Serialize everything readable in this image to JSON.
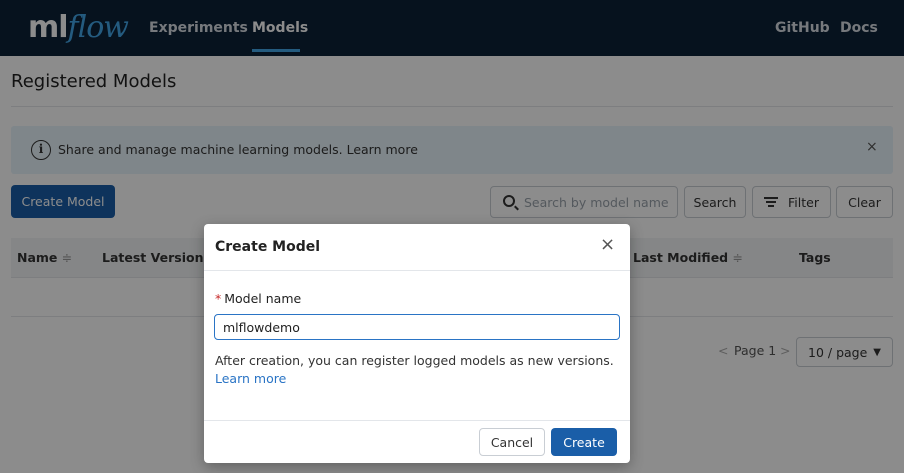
{
  "nav": {
    "logo_ml": "ml",
    "logo_flow": "flow",
    "experiments": "Experiments",
    "models": "Models",
    "github": "GitHub",
    "docs": "Docs"
  },
  "page": {
    "title": "Registered Models",
    "banner_text": "Share and manage machine learning models. Learn more",
    "banner_close": "×",
    "info_icon": "i",
    "create_model_label": "Create Model",
    "search_placeholder": "Search by model name",
    "search_label": "Search",
    "filter_label": "Filter",
    "clear_label": "Clear"
  },
  "table": {
    "columns": [
      {
        "label": "Name",
        "sort": "≑"
      },
      {
        "label": "Latest Version",
        "sort": ""
      },
      {
        "label": "Last Modified",
        "sort": "≑"
      },
      {
        "label": "Tags",
        "sort": ""
      }
    ]
  },
  "pagination": {
    "prev": "<",
    "page_label": "Page 1",
    "next": ">",
    "page_size": "10 / page"
  },
  "modal": {
    "title": "Create Model",
    "close": "×",
    "required_mark": "*",
    "field_label": "Model name",
    "name_value": "mlflowdemo",
    "help_text": "After creation, you can register logged models as new versions.",
    "help_link": "Learn more",
    "cancel_label": "Cancel",
    "create_label": "Create"
  },
  "colors": {
    "nav_bg": "#0c2238",
    "primary": "#1a5ea8",
    "link": "#2a74c5",
    "banner_bg": "#e8f4fb"
  }
}
